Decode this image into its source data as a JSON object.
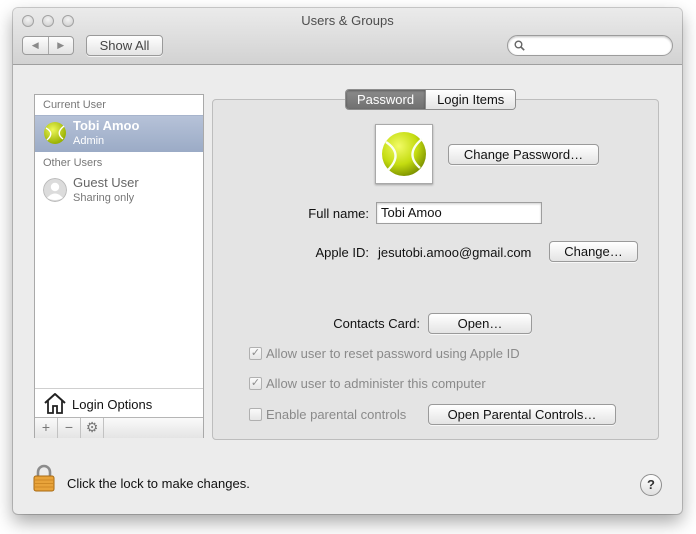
{
  "window": {
    "title": "Users & Groups"
  },
  "toolbar": {
    "back": "◀",
    "forward": "▶",
    "show_all": "Show All",
    "search_placeholder": ""
  },
  "sidebar": {
    "current_user_header": "Current User",
    "current_user": {
      "name": "Tobi Amoo",
      "role": "Admin"
    },
    "other_users_header": "Other Users",
    "guest_user": {
      "name": "Guest User",
      "role": "Sharing only"
    },
    "login_options": "Login Options",
    "add": "+",
    "remove": "−",
    "gear": "⚙"
  },
  "tabs": [
    {
      "label": "Password",
      "active": true
    },
    {
      "label": "Login Items",
      "active": false
    }
  ],
  "main": {
    "change_password": "Change Password…",
    "full_name_label": "Full name:",
    "full_name_value": "Tobi Amoo",
    "apple_id_label": "Apple ID:",
    "apple_id_value": "jesutobi.amoo@gmail.com",
    "change_button": "Change…",
    "contacts_card_label": "Contacts Card:",
    "open_button": "Open…",
    "allow_reset": {
      "label": "Allow user to reset password using Apple ID",
      "checked": true
    },
    "allow_admin": {
      "label": "Allow user to administer this computer",
      "checked": true
    },
    "parental": {
      "label": "Enable parental controls",
      "checked": false
    },
    "open_parental": "Open Parental Controls…"
  },
  "footer": {
    "lock_text": "Click the lock to make changes.",
    "help": "?"
  },
  "colors": {
    "selection": "#a3b2cc",
    "tennis_ball": "#c8e020",
    "lock": "#e8a33a"
  }
}
